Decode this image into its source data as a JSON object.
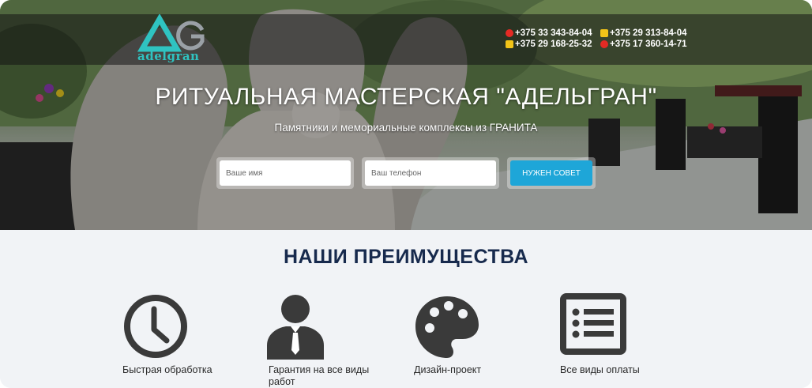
{
  "header": {
    "logo_text": "adelgran",
    "phones": [
      {
        "operator_icon": "mts-icon",
        "number": "+375 33 343-84-04"
      },
      {
        "operator_icon": "a1-icon",
        "number": "+375 29 313-84-04"
      },
      {
        "operator_icon": "a1-icon",
        "number": "+375 29 168-25-32"
      },
      {
        "operator_icon": "mts-icon",
        "number": "+375 17 360-14-71"
      }
    ]
  },
  "hero": {
    "title": "РИТУАЛЬНАЯ МАСТЕРСКАЯ \"АДЕЛЬГРАН\"",
    "subtitle": "Памятники и мемориальные комплексы из ГРАНИТА",
    "form": {
      "name_placeholder": "Ваше имя",
      "phone_placeholder": "Ваш телефон",
      "submit_label": "Нужен совет"
    }
  },
  "advantages": {
    "title": "НАШИ ПРЕИМУЩЕСТВА",
    "items": [
      {
        "icon": "clock-icon",
        "label": "Быстрая обработка"
      },
      {
        "icon": "businessman-icon",
        "label": "Гарантия на все виды работ"
      },
      {
        "icon": "palette-icon",
        "label": "Дизайн-проект"
      },
      {
        "icon": "list-icon",
        "label": "Все виды оплаты"
      }
    ]
  },
  "colors": {
    "accent_blue": "#1ea6d8",
    "logo_teal": "#2fc3c1",
    "heading_navy": "#172a4d",
    "icon_dark": "#3a3a3a"
  }
}
